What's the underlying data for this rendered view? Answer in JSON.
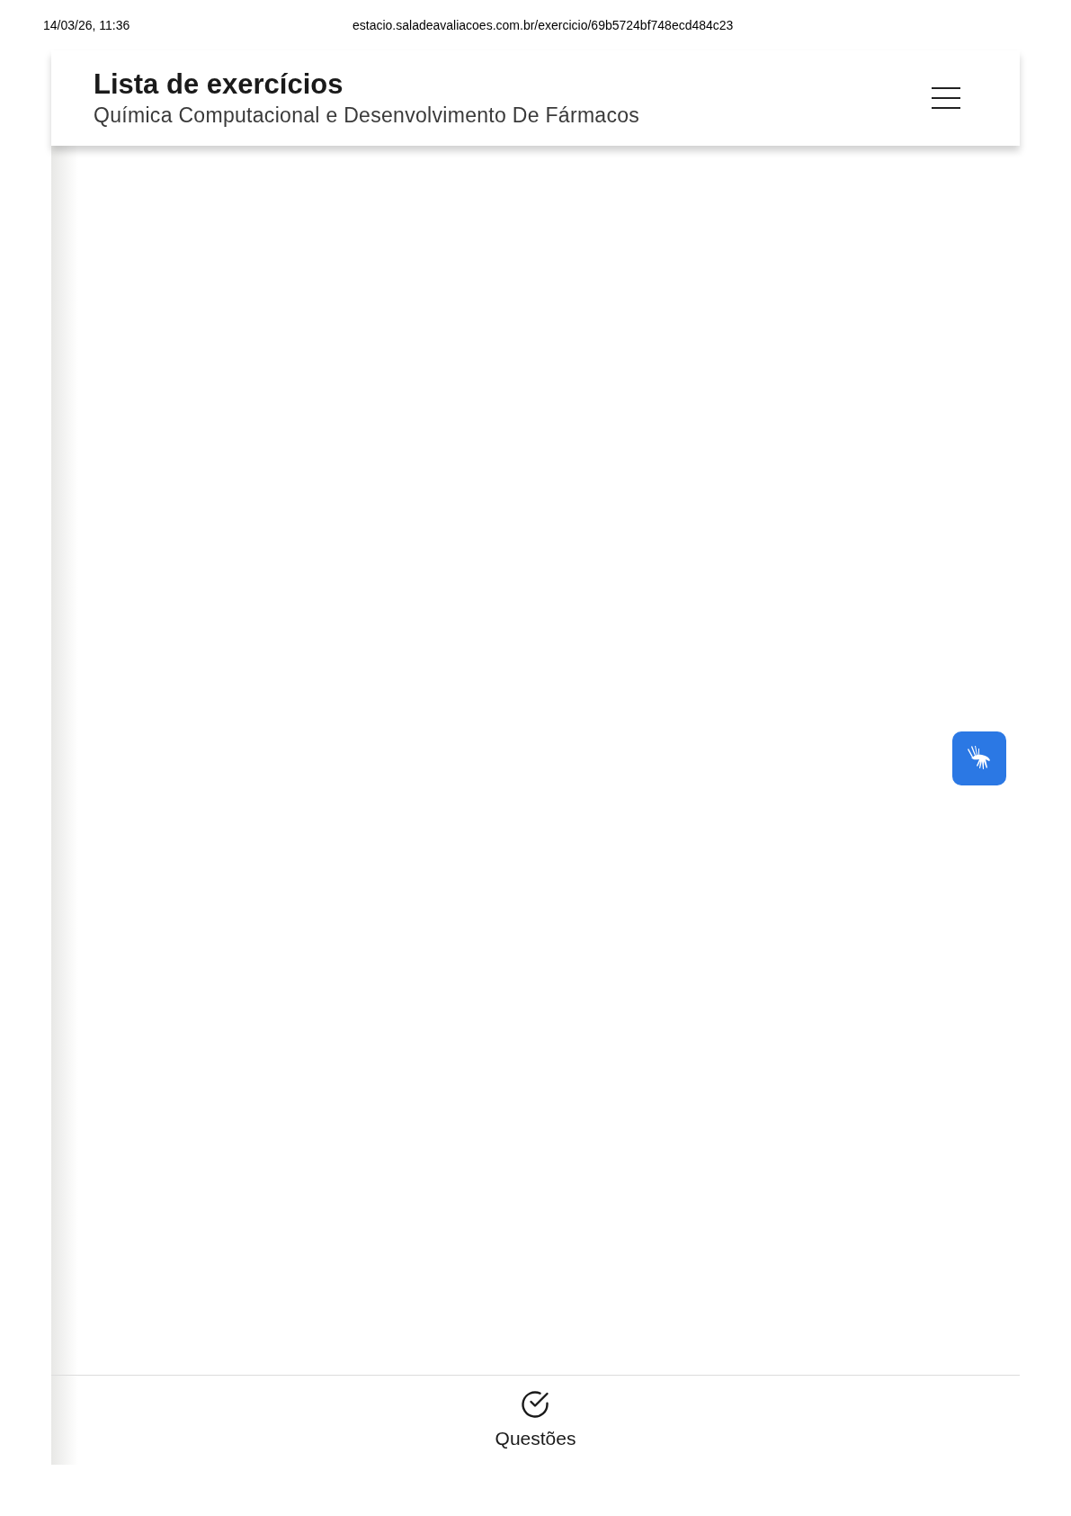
{
  "print_header": {
    "date": "14/03/26, 11:36",
    "url": "estacio.saladeavaliacoes.com.br/exercicio/69b5724bf748ecd484c23"
  },
  "header": {
    "title": "Lista de exercícios",
    "subtitle": "Química Computacional e Desenvolvimento De Fármacos"
  },
  "bottom_nav": [
    {
      "label": "Questões",
      "selected": false
    }
  ]
}
